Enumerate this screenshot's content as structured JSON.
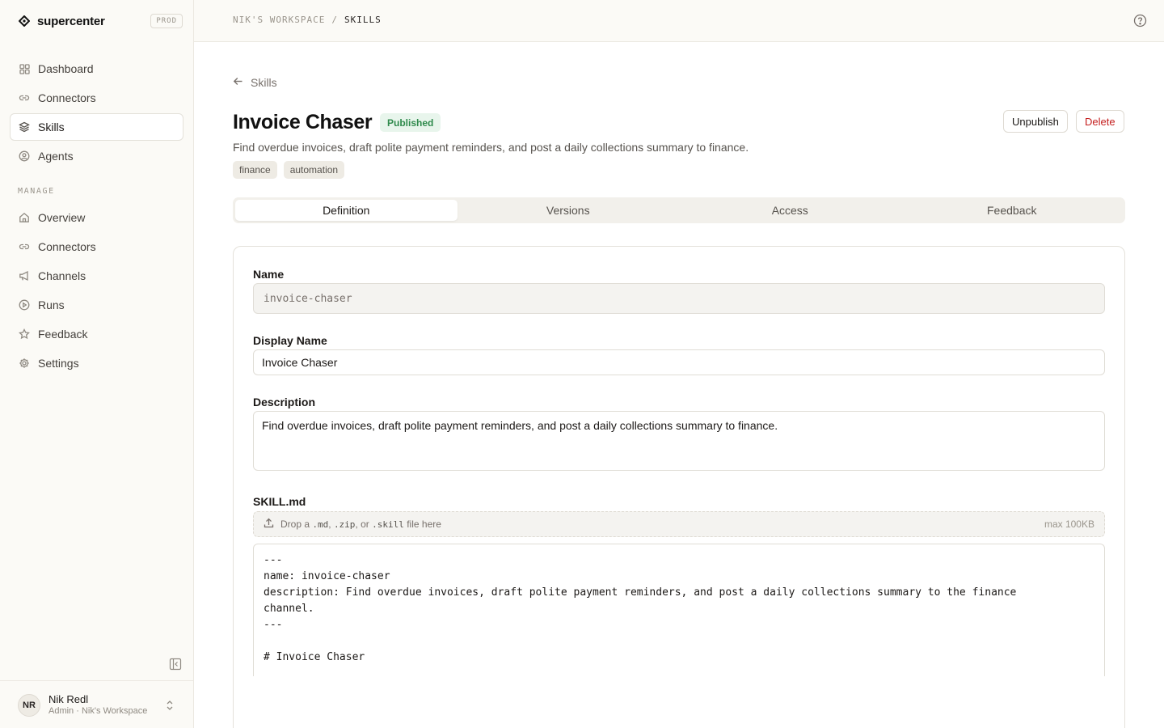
{
  "app": {
    "name": "supercenter",
    "env": "PROD"
  },
  "sidebar": {
    "primary": [
      {
        "label": "Dashboard",
        "icon": "grid-icon"
      },
      {
        "label": "Connectors",
        "icon": "link-icon"
      },
      {
        "label": "Skills",
        "icon": "layers-icon",
        "active": true
      },
      {
        "label": "Agents",
        "icon": "user-circle-icon"
      }
    ],
    "section_label": "MANAGE",
    "manage": [
      {
        "label": "Overview",
        "icon": "home-icon"
      },
      {
        "label": "Connectors",
        "icon": "link-icon"
      },
      {
        "label": "Channels",
        "icon": "megaphone-icon"
      },
      {
        "label": "Runs",
        "icon": "play-circle-icon"
      },
      {
        "label": "Feedback",
        "icon": "star-icon"
      },
      {
        "label": "Settings",
        "icon": "gear-icon"
      }
    ],
    "user": {
      "initials": "NR",
      "name": "Nik Redl",
      "role": "Admin · Nik's Workspace"
    }
  },
  "topbar": {
    "workspace": "NIK'S WORKSPACE",
    "separator": "/",
    "current": "SKILLS"
  },
  "page": {
    "back_label": "Skills",
    "title": "Invoice Chaser",
    "status": "Published",
    "description": "Find overdue invoices, draft polite payment reminders, and post a daily collections summary to finance.",
    "tags": [
      "finance",
      "automation"
    ],
    "actions": {
      "unpublish": "Unpublish",
      "delete": "Delete"
    },
    "tabs": [
      {
        "label": "Definition",
        "active": true
      },
      {
        "label": "Versions"
      },
      {
        "label": "Access"
      },
      {
        "label": "Feedback"
      }
    ]
  },
  "form": {
    "name_label": "Name",
    "name_value": "invoice-chaser",
    "display_name_label": "Display Name",
    "display_name_value": "Invoice Chaser",
    "description_label": "Description",
    "description_value": "Find overdue invoices, draft polite payment reminders, and post a daily collections summary to finance.",
    "skill_label": "SKILL.md",
    "dropzone": {
      "prefix": "Drop a",
      "ext1": ".md",
      "sep1": ",",
      "ext2": ".zip",
      "sep2": ", or",
      "ext3": ".skill",
      "suffix": "file here",
      "max": "max 100KB"
    },
    "editor_lines": [
      "---",
      "name: invoice-chaser",
      "description: Find overdue invoices, draft polite payment reminders, and post a daily collections summary to the finance",
      "channel.",
      "---",
      "",
      "# Invoice Chaser"
    ]
  },
  "colors": {
    "published_bg": "#e8f5ec",
    "published_fg": "#2f8a4c",
    "danger": "#c41d1d",
    "sidebar_bg": "#fbfaf6"
  }
}
